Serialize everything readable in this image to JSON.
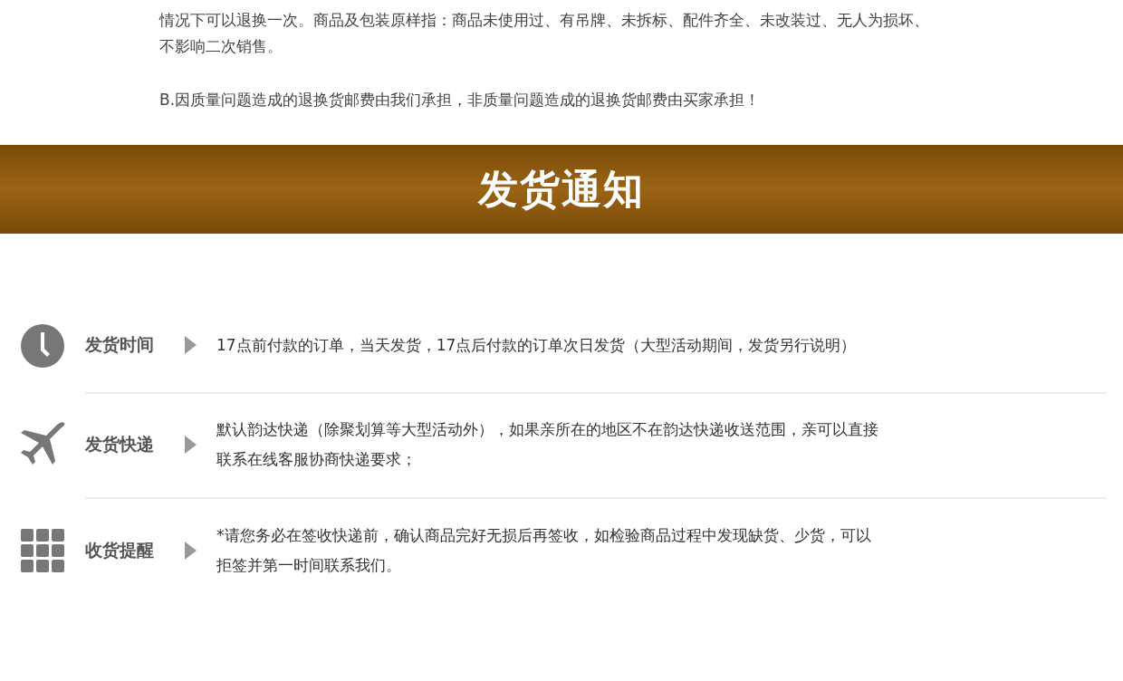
{
  "policy": {
    "paragraphs": [
      {
        "lines": [
          "情况下可以退换一次。商品及包装原样指：商品未使用过、有吊牌、未拆标、配件齐全、未改装过、无人为损坏、",
          "不影响二次销售。"
        ]
      },
      {
        "lines": [
          "B.因质量问题造成的退换货邮费由我们承担，非质量问题造成的退换货邮费由买家承担！"
        ]
      }
    ]
  },
  "banner": {
    "title": "发货通知"
  },
  "rows": [
    {
      "kind": "clock",
      "label": "发货时间",
      "lines": [
        "17点前付款的订单，当天发货，17点后付款的订单次日发货（大型活动期间，发货另行说明）"
      ]
    },
    {
      "kind": "plane",
      "label": "发货快递",
      "lines": [
        "默认韵达快递（除聚划算等大型活动外），如果亲所在的地区不在韵达快递收送范围，亲可以直接",
        "联系在线客服协商快递要求；"
      ]
    },
    {
      "kind": "grid",
      "label": "收货提醒",
      "lines": [
        "*请您务必在签收快递前，确认商品完好无损后再签收，如检验商品过程中发现缺货、少货，可以",
        "拒签并第一时间联系我们。"
      ]
    }
  ]
}
